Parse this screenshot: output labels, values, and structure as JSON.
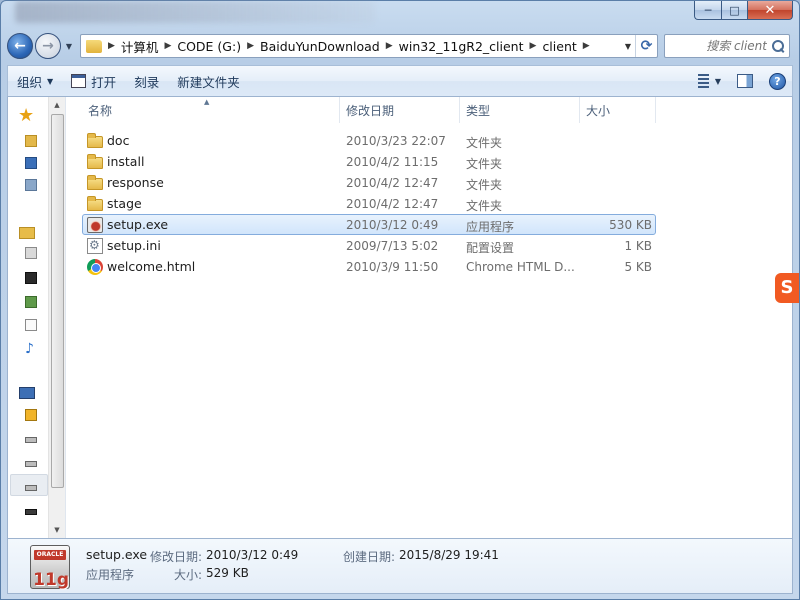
{
  "window": {
    "caption": {
      "minimize": "─",
      "maximize": "□",
      "close": "✕"
    }
  },
  "nav": {
    "back_glyph": "←",
    "forward_glyph": "→",
    "breadcrumbs": [
      {
        "label": "计算机"
      },
      {
        "label": "CODE (G:)"
      },
      {
        "label": "BaiduYunDownload"
      },
      {
        "label": "win32_11gR2_client"
      },
      {
        "label": "client"
      }
    ],
    "refresh_glyph": "⟳",
    "search_placeholder": "搜索 client"
  },
  "toolbar": {
    "organize": "组织",
    "open": "打开",
    "burn": "刻录",
    "new_folder": "新建文件夹",
    "help": "?"
  },
  "columns": {
    "name": "名称",
    "modified": "修改日期",
    "type": "类型",
    "size": "大小"
  },
  "files": [
    {
      "name": "doc",
      "modified": "2010/3/23 22:07",
      "type": "文件夹",
      "size": "",
      "icon": "folder-icon",
      "selected": false
    },
    {
      "name": "install",
      "modified": "2010/4/2 11:15",
      "type": "文件夹",
      "size": "",
      "icon": "folder-icon",
      "selected": false
    },
    {
      "name": "response",
      "modified": "2010/4/2 12:47",
      "type": "文件夹",
      "size": "",
      "icon": "folder-icon",
      "selected": false
    },
    {
      "name": "stage",
      "modified": "2010/4/2 12:47",
      "type": "文件夹",
      "size": "",
      "icon": "folder-icon",
      "selected": false
    },
    {
      "name": "setup.exe",
      "modified": "2010/3/12 0:49",
      "type": "应用程序",
      "size": "530 KB",
      "icon": "exe-icon",
      "selected": true
    },
    {
      "name": "setup.ini",
      "modified": "2009/7/13 5:02",
      "type": "配置设置",
      "size": "1 KB",
      "icon": "ini-icon",
      "selected": false
    },
    {
      "name": "welcome.html",
      "modified": "2010/3/9 11:50",
      "type": "Chrome HTML D...",
      "size": "5 KB",
      "icon": "chrome-icon",
      "selected": false
    }
  ],
  "details": {
    "filename": "setup.exe",
    "modified_label": "修改日期:",
    "modified_value": "2010/3/12 0:49",
    "created_label": "创建日期:",
    "created_value": "2015/8/29 19:41",
    "type_value": "应用程序",
    "size_label": "大小:",
    "size_value": "529 KB",
    "icon_text_band": "ORACLE",
    "icon_text_version": "11g"
  },
  "ime": {
    "label": "S"
  },
  "colors": {
    "selection_border": "#84acdd",
    "accent": "#3b5b86"
  }
}
